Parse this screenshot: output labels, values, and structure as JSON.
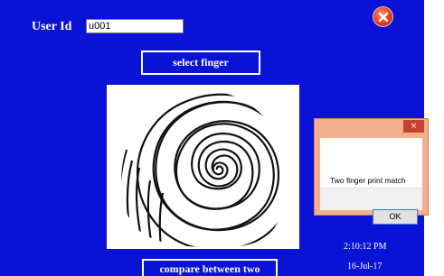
{
  "form": {
    "userid_label": "User Id",
    "userid_value": "u001",
    "select_button": "select  finger",
    "compare_button": "compare between two",
    "time": "2:10:12 PM",
    "date": "16-Jul-17"
  },
  "dialog": {
    "message": "Two finger print match",
    "ok_label": "OK",
    "close_glyph": "×"
  },
  "icons": {
    "window_close": "close-icon",
    "fingerprint": "fingerprint-image"
  },
  "colors": {
    "window_background": "#0a12d6",
    "button_border": "#ffffff",
    "close_button": "#e63a1f",
    "dialog_frame": "#f3b08e",
    "dialog_close": "#c7432f"
  }
}
